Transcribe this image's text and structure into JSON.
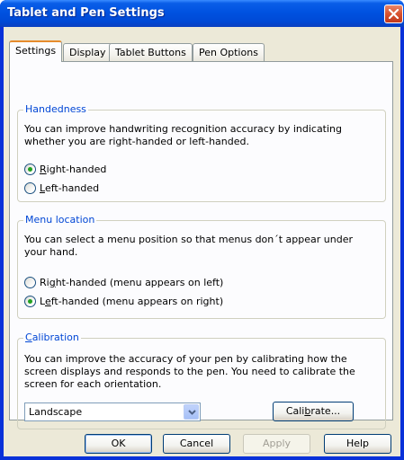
{
  "window": {
    "title": "Tablet and Pen Settings"
  },
  "tabs": [
    {
      "label": "Settings"
    },
    {
      "label": "Display"
    },
    {
      "label": "Tablet Buttons"
    },
    {
      "label": "Pen Options"
    }
  ],
  "handedness": {
    "title": "Handedness",
    "description": "You can improve handwriting recognition accuracy by indicating whether you are right-handed or left-handed.",
    "right": {
      "label_underlined": "R",
      "label_rest": "ight-handed",
      "checked": true
    },
    "left": {
      "label_underlined": "L",
      "label_rest": "eft-handed",
      "checked": false
    }
  },
  "menu_location": {
    "title": "Menu location",
    "description": "You can select a menu position so that menus don´t appear under your hand.",
    "right": {
      "label_pre": "Ri",
      "label_underlined": "g",
      "label_rest": "ht-handed (menu appears on left)",
      "checked": false
    },
    "left": {
      "label_pre": "L",
      "label_underlined": "e",
      "label_rest": "ft-handed (menu appears on right)",
      "checked": true
    }
  },
  "calibration": {
    "title_underlined": "C",
    "title_rest": "alibration",
    "description": "You can improve the accuracy of your pen by calibrating how the screen displays and responds to the pen. You need to calibrate the screen for each orientation.",
    "orientation_value": "Landscape",
    "calibrate_pre": "Cali",
    "calibrate_underlined": "b",
    "calibrate_rest": "rate..."
  },
  "buttons": {
    "ok": "OK",
    "cancel": "Cancel",
    "apply": "Apply",
    "help": "Help"
  },
  "colors": {
    "titlebar": "#0054e3",
    "group_title": "#0046d5",
    "active_tab_accent": "#e68b2c",
    "radio_dot": "#21a121"
  }
}
